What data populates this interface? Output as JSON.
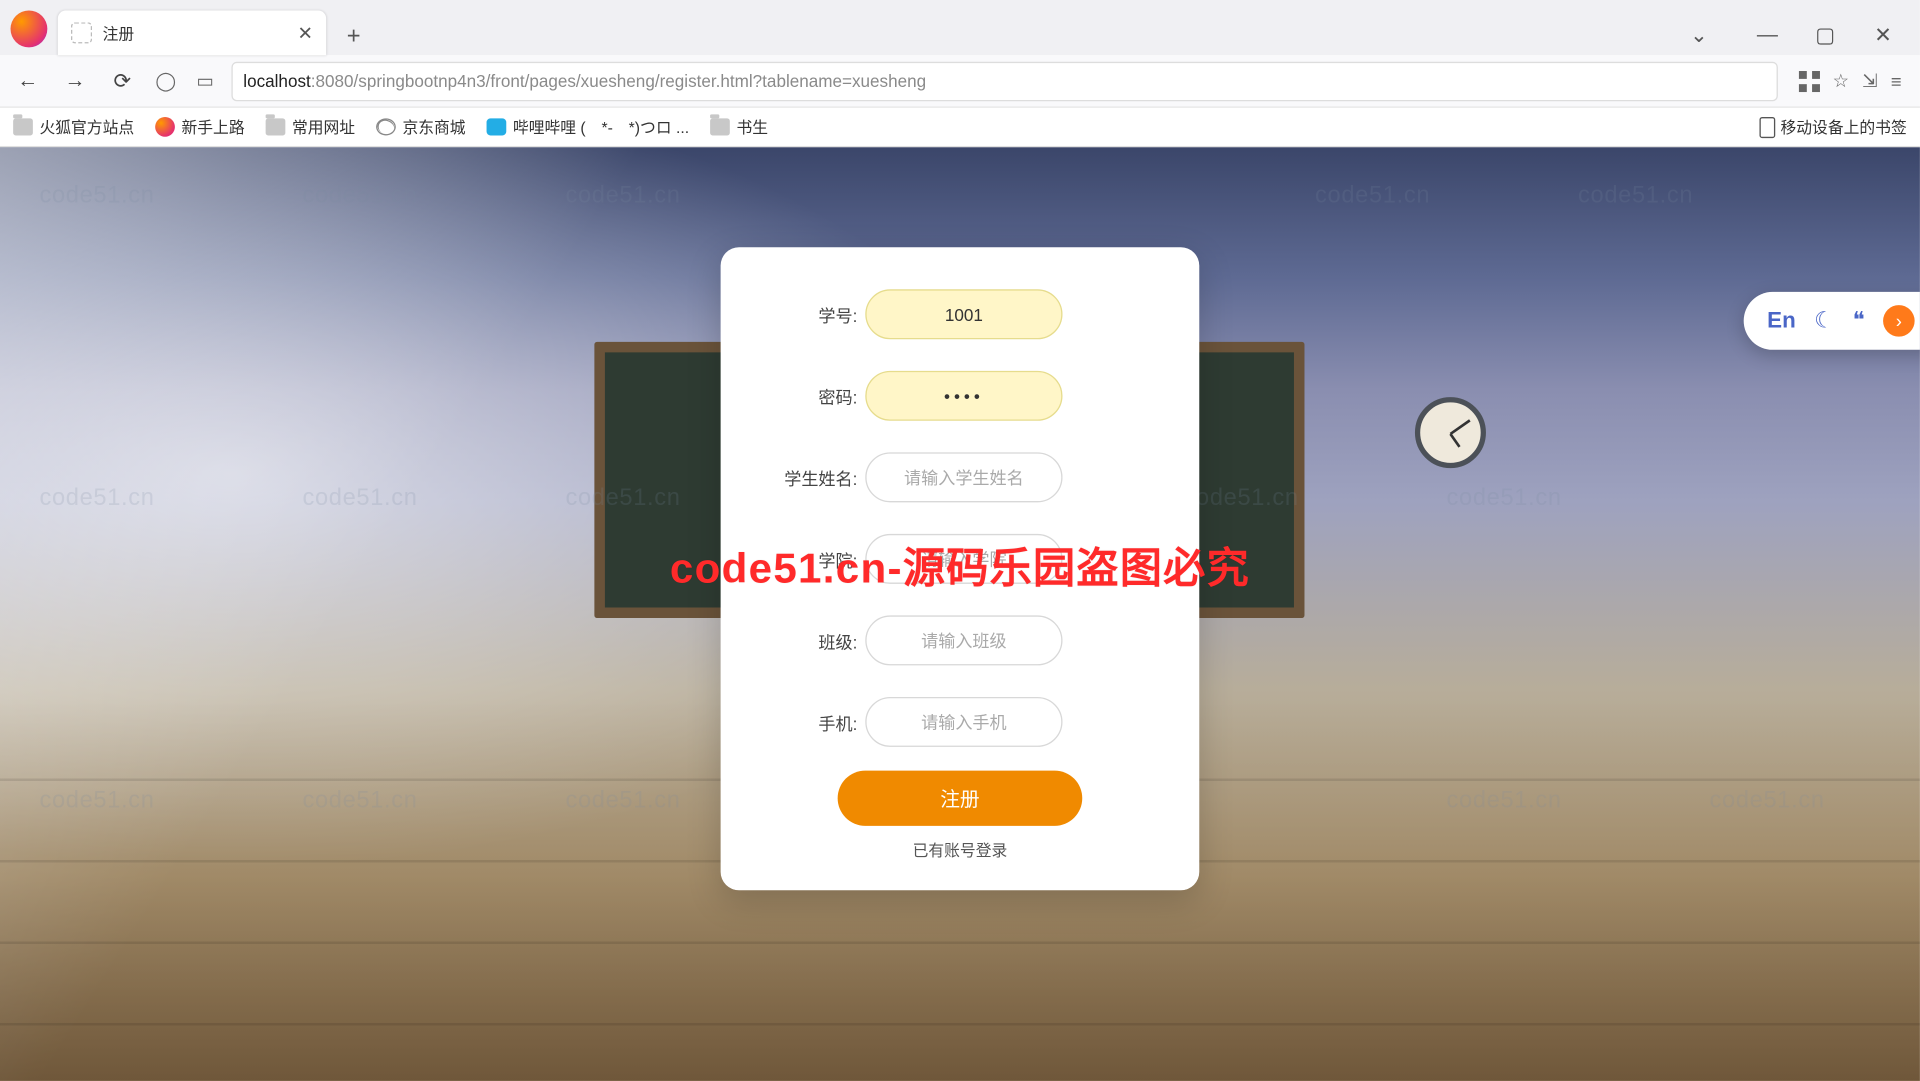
{
  "browser": {
    "tab_title": "注册",
    "url_host": "localhost",
    "url_path": ":8080/springbootnp4n3/front/pages/xuesheng/register.html?tablename=xuesheng",
    "back": "←",
    "forward": "→",
    "reload": "⟳",
    "new_tab": "+",
    "chevron": "⌄",
    "minimize": "—",
    "maximize": "▢",
    "close": "✕",
    "tab_close": "✕",
    "bookmark_nav": "☆",
    "ext_icon": "⇲",
    "menu": "≡"
  },
  "bookmarks": {
    "b1": "火狐官方站点",
    "b2": "新手上路",
    "b3": "常用网址",
    "b4": "京东商城",
    "b5": "哔哩哔哩 (　*-　*)つロ ...",
    "b6": "书生",
    "mobile": "移动设备上的书签"
  },
  "watermark": "code51.cn",
  "overlay": "code51.cn-源码乐园盗图必究",
  "form": {
    "student_id_label": "学号:",
    "student_id_value": "1001",
    "password_label": "密码:",
    "password_value": "••••",
    "name_label": "学生姓名:",
    "name_placeholder": "请输入学生姓名",
    "college_label": "学院:",
    "college_placeholder": "请输入学院",
    "class_label": "班级:",
    "class_placeholder": "请输入班级",
    "phone_label": "手机:",
    "phone_placeholder": "请输入手机",
    "submit": "注册",
    "login_link": "已有账号登录"
  },
  "lang_pill": {
    "en": "En",
    "moon": "☾",
    "quote": "❝",
    "arrow": "›"
  }
}
